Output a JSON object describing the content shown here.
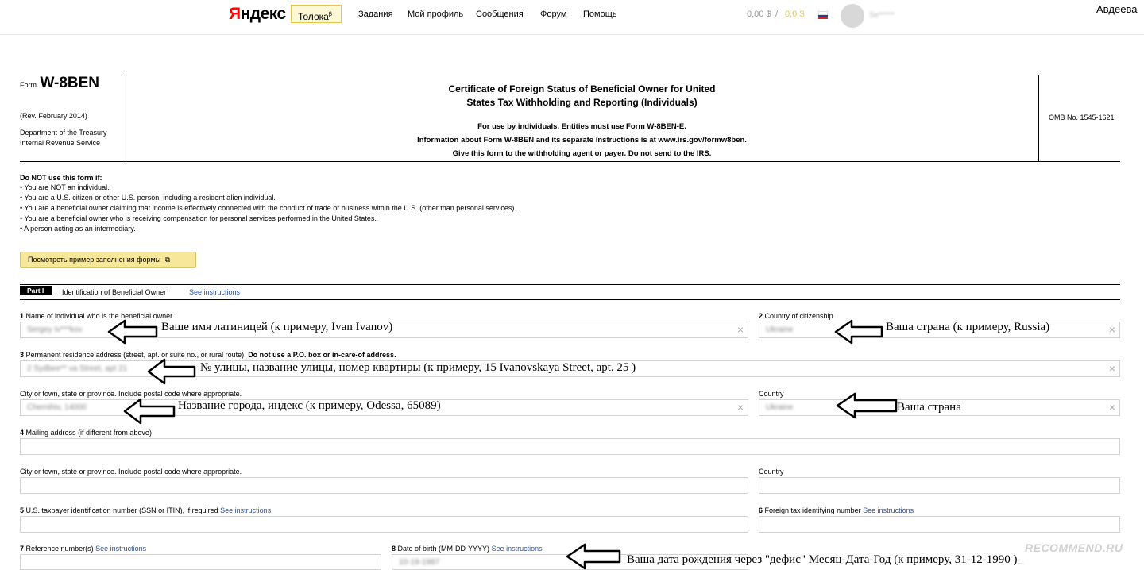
{
  "topbar": {
    "logo_y": "Я",
    "logo_rest": "ндекс",
    "toloka": "Толока",
    "toloka_sup": "β",
    "nav": [
      "Задания",
      "Мой профиль",
      "Сообщения",
      "Форум",
      "Помощь"
    ],
    "balance1": "0,00 $",
    "balance_sep": "/",
    "balance2": "0,0  $",
    "username_blurred": "Se*****",
    "corner_name": "Авдеева"
  },
  "form_header": {
    "form_word": "Form",
    "form_id": "W-8BEN",
    "rev": "(Rev. February 2014)",
    "dept1": "Department of the Treasury",
    "dept2": "Internal Revenue Service",
    "title1": "Certificate of Foreign Status of Beneficial Owner for United",
    "title2": "States Tax Withholding and Reporting (Individuals)",
    "line1": "For use by individuals. Entities must use Form W-8BEN-E.",
    "line2": "Information about Form W-8BEN and its separate instructions is at www.irs.gov/formw8ben.",
    "line3": "Give this form to the withholding agent or payer. Do not send to the IRS.",
    "omb": "OMB No. 1545-1621"
  },
  "donot": {
    "heading": "Do NOT use this form if:",
    "items": [
      "You are NOT an individual.",
      "You are a U.S. citizen or other U.S. person, including a resident alien individual.",
      "You are a beneficial owner claiming that income is effectively connected with the conduct of trade or business within the U.S. (other than personal services).",
      "You are a beneficial owner who is receiving compensation for personal services performed in the United States.",
      "A person acting as an intermediary."
    ]
  },
  "example_button": "Посмотреть пример заполнения формы",
  "part1": {
    "tag": "Part I",
    "title": "Identification of Beneficial Owner",
    "see": "See instructions"
  },
  "fields": {
    "f1_num": "1",
    "f1_label": "Name of individual who is the beneficial owner",
    "f1_value": "Sergey Iv***kov",
    "f2_num": "2",
    "f2_label": "Country of citizenship",
    "f2_value": "Ukraine",
    "f3_num": "3",
    "f3_label": "Permanent residence address (street, apt. or suite no., or rural route).",
    "f3_bold": "Do not use a P.O. box or in-care-of address.",
    "f3_value": "2 Sydbee** va Street, apt 21",
    "city_label": "City or town, state or province. Include postal code where appropriate.",
    "city_value": "Chernihiv, 14000",
    "country_label": "Country",
    "country_value": "Ukraine",
    "f4_num": "4",
    "f4_label": "Mailing address (if different from above)",
    "city2_label": "City or town, state or province. Include postal code where appropriate.",
    "country2_label": "Country",
    "f5_num": "5",
    "f5_label": "U.S. taxpayer identification number (SSN or ITIN), if required",
    "f5_see": "See instructions",
    "f6_num": "6",
    "f6_label": "Foreign tax identifying number",
    "f6_see": "See instructions",
    "f7_num": "7",
    "f7_label": "Reference number(s)",
    "f7_see": "See instructions",
    "f8_num": "8",
    "f8_label": "Date of birth (MM-DD-YYYY)",
    "f8_see": "See instructions",
    "f8_value": "10-19-1987"
  },
  "annotations": {
    "a1": "Ваше имя латиницей (к примеру, Ivan Ivanov)",
    "a2": "Ваша страна (к примеру, Russia)",
    "a3": "№ улицы, название улицы, номер квартиры (к примеру, 15 Ivanovskaya Street, apt. 25 )",
    "a4": "Название города, индекс (к примеру, Odessa, 65089)",
    "a5": "Ваша страна",
    "a6": "Ваша дата рождения через \"дефис\" Месяц-Дата-Год (к примеру, 31-12-1990 )_"
  },
  "watermark": "RECOMMEND.RU",
  "colors": {
    "accent_yellow": "#f6e79a",
    "link_blue": "#2b4fa1",
    "logo_red": "#ff0000"
  }
}
